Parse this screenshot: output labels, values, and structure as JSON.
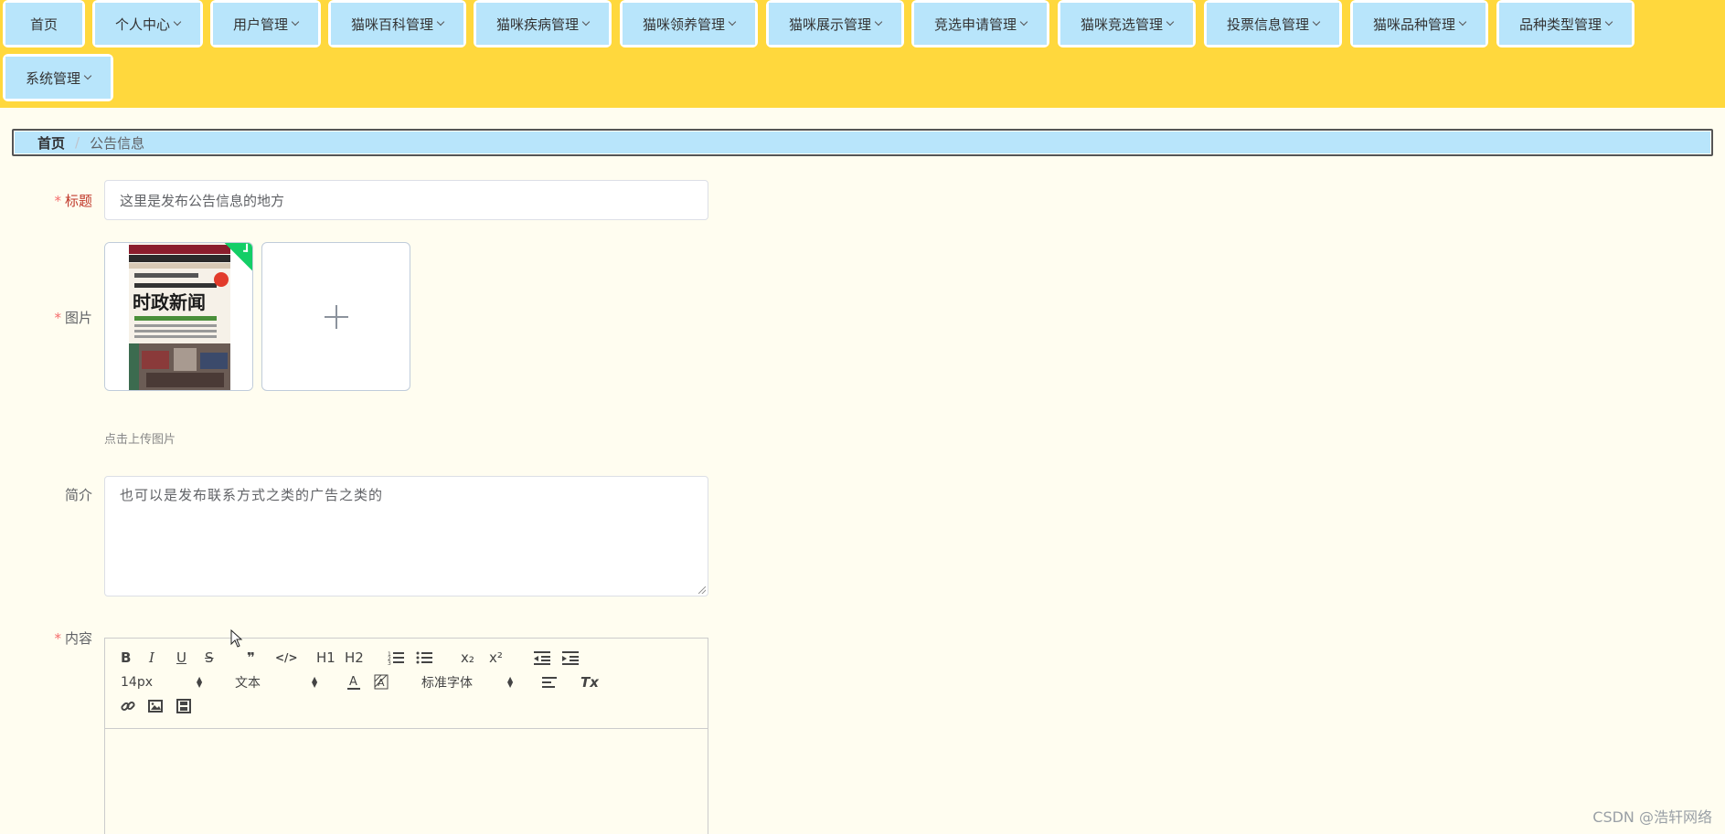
{
  "nav": {
    "items": [
      {
        "label": "首页",
        "has_dropdown": false
      },
      {
        "label": "个人中心",
        "has_dropdown": true
      },
      {
        "label": "用户管理",
        "has_dropdown": true
      },
      {
        "label": "猫咪百科管理",
        "has_dropdown": true
      },
      {
        "label": "猫咪疾病管理",
        "has_dropdown": true
      },
      {
        "label": "猫咪领养管理",
        "has_dropdown": true
      },
      {
        "label": "猫咪展示管理",
        "has_dropdown": true
      },
      {
        "label": "竞选申请管理",
        "has_dropdown": true
      },
      {
        "label": "猫咪竞选管理",
        "has_dropdown": true
      },
      {
        "label": "投票信息管理",
        "has_dropdown": true
      },
      {
        "label": "猫咪品种管理",
        "has_dropdown": true
      },
      {
        "label": "品种类型管理",
        "has_dropdown": true
      },
      {
        "label": "系统管理",
        "has_dropdown": true
      }
    ]
  },
  "breadcrumb": {
    "home": "首页",
    "separator": "/",
    "current": "公告信息"
  },
  "form": {
    "title_label": "标题",
    "title_value": "这里是发布公告信息的地方",
    "image_label": "图片",
    "image_thumbnail": {
      "headline": "时政新闻",
      "banner": "HOTTEST POLITICAL NEWS",
      "subtitle": "深度阅读 世界知名报刊"
    },
    "upload_hint": "点击上传图片",
    "intro_label": "简介",
    "intro_value": "也可以是发布联系方式之类的广告之类的",
    "content_label": "内容",
    "required_mark": "*"
  },
  "editor": {
    "font_size": "14px",
    "header_picker": "文本",
    "font_family": "标准字体",
    "buttons": {
      "bold": "B",
      "italic": "I",
      "underline": "U",
      "strike": "S",
      "quote": "❞",
      "code": "</>",
      "h1": "H1",
      "h2": "H2",
      "subscript": "x₂",
      "superscript": "x²",
      "clean": "Tx"
    }
  },
  "watermark": "CSDN @浩轩网络",
  "colors": {
    "nav_bg": "#ffd83d",
    "nav_item_bg": "#b8e5fb",
    "page_bg": "#fffdf0",
    "required": "#f56c6c",
    "success": "#13ce66"
  }
}
